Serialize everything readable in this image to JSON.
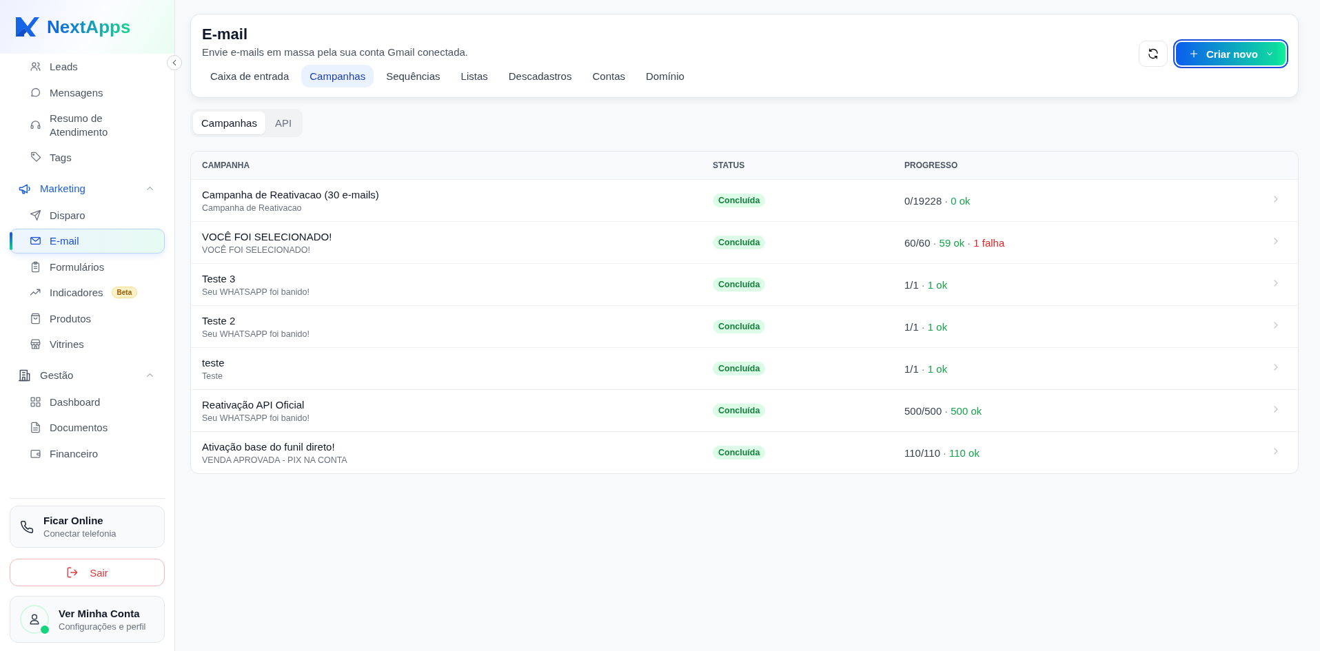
{
  "brand": {
    "name": "NextApps"
  },
  "sidebar": {
    "sections": [
      {
        "items": [
          {
            "label": "Leads",
            "selected": false
          },
          {
            "label": "Mensagens",
            "selected": false
          },
          {
            "label": "Resumo de Atendimento",
            "selected": false
          },
          {
            "label": "Tags",
            "selected": false
          }
        ]
      },
      {
        "title": "Marketing",
        "selected": true,
        "expanded": true,
        "items": [
          {
            "label": "Disparo",
            "selected": false
          },
          {
            "label": "E-mail",
            "selected": true
          },
          {
            "label": "Formulários",
            "selected": false
          },
          {
            "label": "Indicadores",
            "selected": false,
            "badge": "Beta"
          },
          {
            "label": "Produtos",
            "selected": false
          },
          {
            "label": "Vitrines",
            "selected": false
          }
        ]
      },
      {
        "title": "Gestão",
        "selected": false,
        "expanded": true,
        "items": [
          {
            "label": "Dashboard",
            "selected": false
          },
          {
            "label": "Documentos",
            "selected": false
          },
          {
            "label": "Financeiro",
            "selected": false
          }
        ]
      }
    ],
    "online_card": {
      "title": "Ficar Online",
      "subtitle": "Conectar telefonia"
    },
    "logout": "Sair",
    "account": {
      "title": "Ver Minha Conta",
      "subtitle": "Configurações e perfil",
      "online": true
    }
  },
  "header": {
    "title": "E-mail",
    "subtitle": "Envie e-mails em massa pela sua conta Gmail conectada.",
    "create_button": "Criar novo",
    "tabs": [
      {
        "label": "Caixa de entrada",
        "selected": false
      },
      {
        "label": "Campanhas",
        "selected": true
      },
      {
        "label": "Sequências",
        "selected": false
      },
      {
        "label": "Listas",
        "selected": false
      },
      {
        "label": "Descadastros",
        "selected": false
      },
      {
        "label": "Contas",
        "selected": false
      },
      {
        "label": "Domínio",
        "selected": false
      }
    ]
  },
  "subtabs": [
    {
      "label": "Campanhas",
      "selected": true
    },
    {
      "label": "API",
      "selected": false
    }
  ],
  "table": {
    "columns": [
      "CAMPANHA",
      "STATUS",
      "PROGRESSO"
    ],
    "rows": [
      {
        "name": "Campanha de Reativacao (30 e-mails)",
        "subject": "Campanha de Reativacao",
        "status": "Concluída",
        "progress": [
          {
            "kind": "total",
            "text": "0/19228"
          },
          {
            "kind": "sep",
            "text": "·"
          },
          {
            "kind": "ok",
            "text": "0 ok"
          }
        ]
      },
      {
        "name": "VOCÊ FOI SELECIONADO!",
        "subject": "VOCÊ FOI SELECIONADO!",
        "status": "Concluída",
        "progress": [
          {
            "kind": "total",
            "text": "60/60"
          },
          {
            "kind": "sep",
            "text": "·"
          },
          {
            "kind": "ok",
            "text": "59 ok"
          },
          {
            "kind": "sep",
            "text": "·"
          },
          {
            "kind": "fail",
            "text": "1 falha"
          }
        ]
      },
      {
        "name": "Teste 3",
        "subject": "Seu WHATSAPP foi banido!",
        "status": "Concluída",
        "progress": [
          {
            "kind": "total",
            "text": "1/1"
          },
          {
            "kind": "sep",
            "text": "·"
          },
          {
            "kind": "ok",
            "text": "1 ok"
          }
        ]
      },
      {
        "name": "Teste 2",
        "subject": "Seu WHATSAPP foi banido!",
        "status": "Concluída",
        "progress": [
          {
            "kind": "total",
            "text": "1/1"
          },
          {
            "kind": "sep",
            "text": "·"
          },
          {
            "kind": "ok",
            "text": "1 ok"
          }
        ]
      },
      {
        "name": "teste",
        "subject": "Teste",
        "status": "Concluída",
        "progress": [
          {
            "kind": "total",
            "text": "1/1"
          },
          {
            "kind": "sep",
            "text": "·"
          },
          {
            "kind": "ok",
            "text": "1 ok"
          }
        ]
      },
      {
        "name": "Reativação API Oficial",
        "subject": "Seu WHATSAPP foi banido!",
        "status": "Concluída",
        "progress": [
          {
            "kind": "total",
            "text": "500/500"
          },
          {
            "kind": "sep",
            "text": "·"
          },
          {
            "kind": "ok",
            "text": "500 ok"
          }
        ]
      },
      {
        "name": "Ativação base do funil direto!",
        "subject": "VENDA APROVADA - PIX NA CONTA",
        "status": "Concluída",
        "progress": [
          {
            "kind": "total",
            "text": "110/110"
          },
          {
            "kind": "sep",
            "text": "·"
          },
          {
            "kind": "ok",
            "text": "110 ok"
          }
        ]
      }
    ]
  }
}
